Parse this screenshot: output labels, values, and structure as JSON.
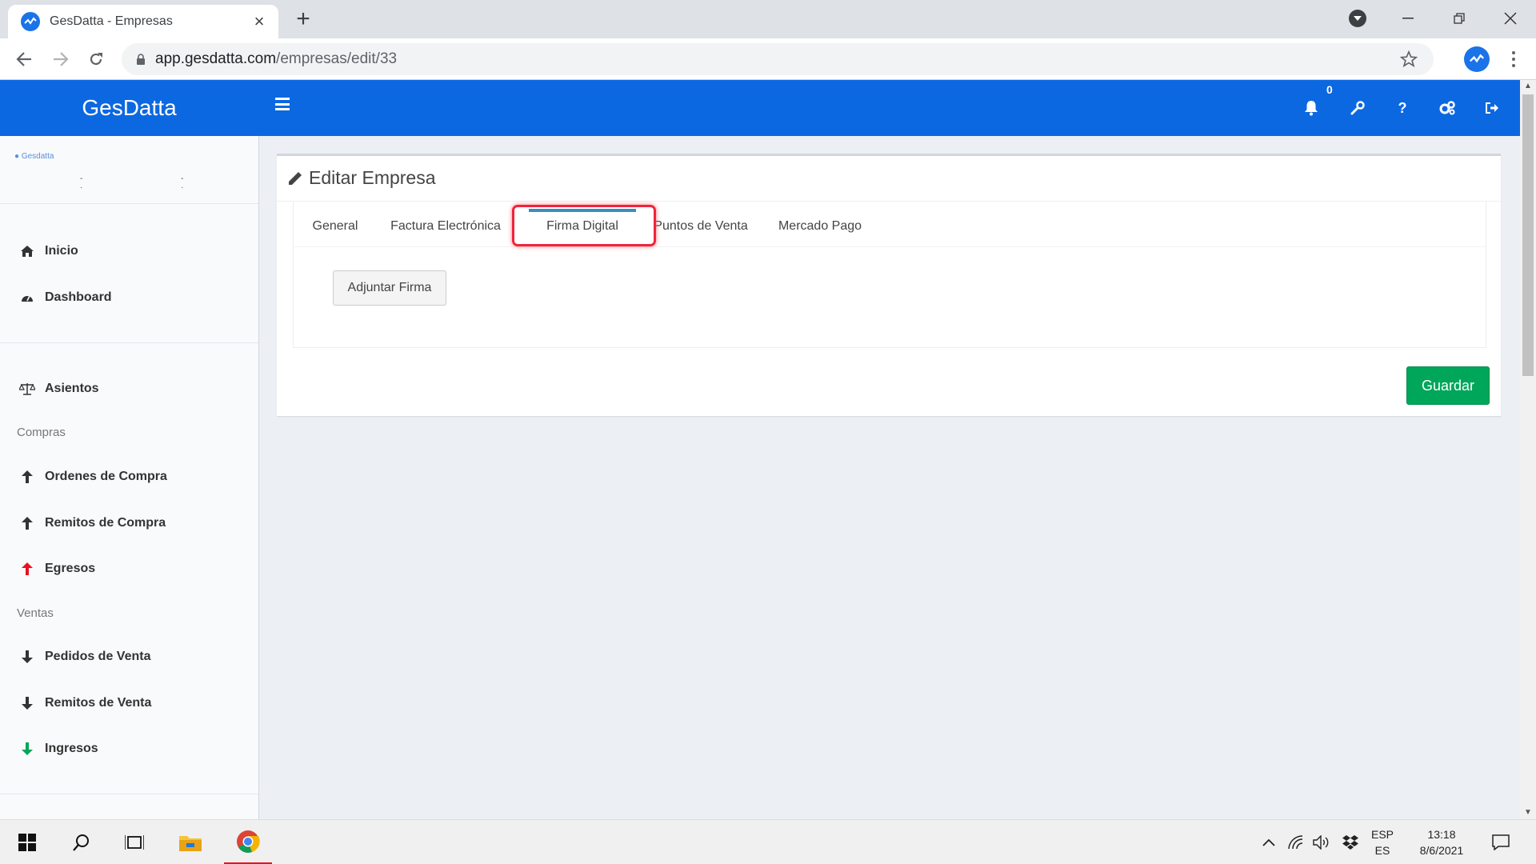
{
  "browser": {
    "tab_title": "GesDatta - Empresas",
    "url_host": "app.gesdatta.com",
    "url_path": "/empresas/edit/33"
  },
  "header": {
    "brand": "GesDatta",
    "notification_count": "0"
  },
  "sidebar": {
    "logo_text": "Gesdatta",
    "logo_subtext": "- - · ·",
    "items_top": [
      {
        "label": "Inicio",
        "icon": "home-icon"
      },
      {
        "label": "Dashboard",
        "icon": "dashboard-icon"
      }
    ],
    "asientos": {
      "label": "Asientos",
      "icon": "balance-scale-icon"
    },
    "compras_header": "Compras",
    "compras_items": [
      {
        "label": "Ordenes de Compra",
        "icon": "arrow-up-icon",
        "color": "#333333"
      },
      {
        "label": "Remitos de Compra",
        "icon": "arrow-up-icon",
        "color": "#333333"
      },
      {
        "label": "Egresos",
        "icon": "arrow-up-icon",
        "color": "#e81123"
      }
    ],
    "ventas_header": "Ventas",
    "ventas_items": [
      {
        "label": "Pedidos de Venta",
        "icon": "arrow-down-icon",
        "color": "#333333"
      },
      {
        "label": "Remitos de Venta",
        "icon": "arrow-down-icon",
        "color": "#333333"
      },
      {
        "label": "Ingresos",
        "icon": "arrow-down-icon",
        "color": "#00a65a"
      }
    ]
  },
  "main": {
    "title": "Editar Empresa",
    "tabs": [
      {
        "label": "General"
      },
      {
        "label": "Factura Electrónica"
      },
      {
        "label": "Firma Digital",
        "active": true
      },
      {
        "label": "Puntos de Venta"
      },
      {
        "label": "Mercado Pago"
      }
    ],
    "attach_button": "Adjuntar Firma",
    "save_button": "Guardar"
  },
  "taskbar": {
    "lang_line1": "ESP",
    "lang_line2": "ES",
    "time": "13:18",
    "date": "8/6/2021"
  },
  "colors": {
    "header_blue": "#0c68e1",
    "save_green": "#00a65a",
    "highlight_red": "#f0243a"
  }
}
